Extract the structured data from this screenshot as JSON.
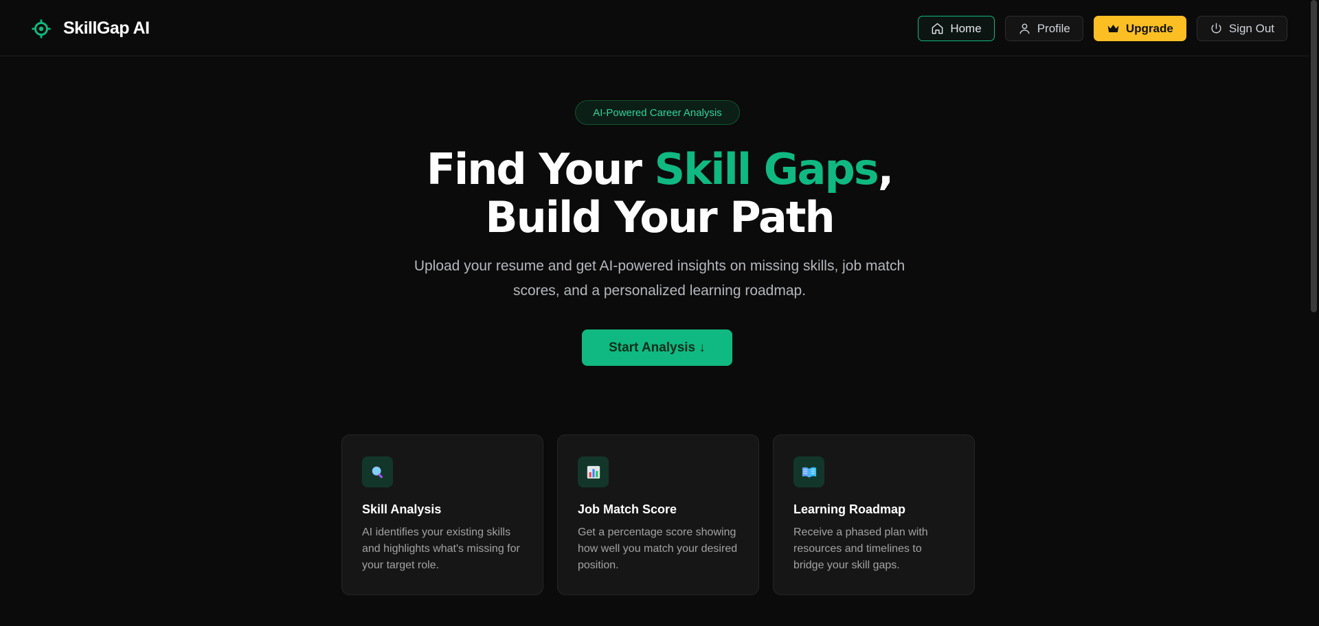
{
  "brand": {
    "name": "SkillGap AI",
    "logo_icon": "target-icon",
    "accent": "#10b981"
  },
  "nav": {
    "home": {
      "label": "Home",
      "icon": "home-icon"
    },
    "profile": {
      "label": "Profile",
      "icon": "user-icon"
    },
    "upgrade": {
      "label": "Upgrade",
      "icon": "crown-icon",
      "color": "#fbbf24"
    },
    "signout": {
      "label": "Sign Out",
      "icon": "power-icon"
    }
  },
  "hero": {
    "badge": "AI-Powered Career Analysis",
    "title_part1": "Find Your ",
    "title_accent": "Skill Gaps",
    "title_part2": ",",
    "title_line2": "Build Your Path",
    "subtitle": "Upload your resume and get AI-powered insights on missing skills, job match scores, and a personalized learning roadmap.",
    "cta_label": "Start Analysis ↓"
  },
  "features": [
    {
      "title": "Skill Analysis",
      "description": "AI identifies your existing skills and highlights what's missing for your target role.",
      "icon": "magnifier-icon"
    },
    {
      "title": "Job Match Score",
      "description": "Get a percentage score showing how well you match your desired position.",
      "icon": "bar-chart-icon"
    },
    {
      "title": "Learning Roadmap",
      "description": "Receive a phased plan with resources and timelines to bridge your skill gaps.",
      "icon": "open-book-icon"
    }
  ]
}
